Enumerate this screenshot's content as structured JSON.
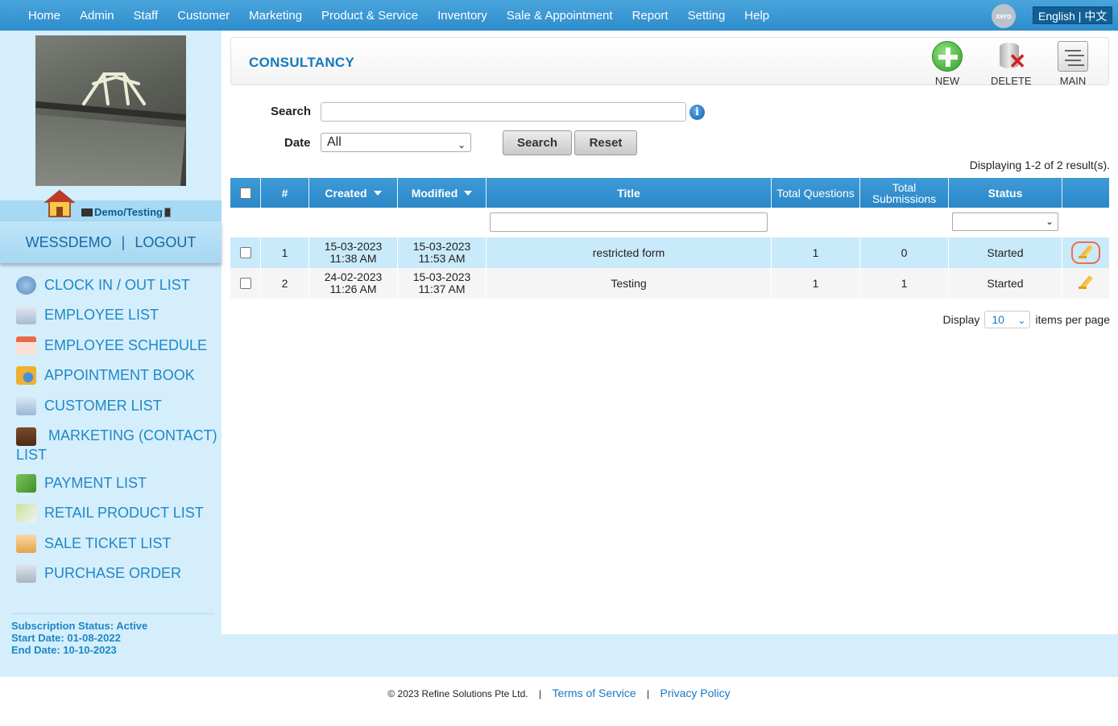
{
  "nav": {
    "items": [
      "Home",
      "Admin",
      "Staff",
      "Customer",
      "Marketing",
      "Product & Service",
      "Inventory",
      "Sale & Appointment",
      "Report",
      "Setting",
      "Help"
    ],
    "xero": "xero",
    "language": "English | 中文"
  },
  "sidebar": {
    "branch_label": "Demo/Testing",
    "username": "WESSDEMO",
    "separator": "|",
    "logout": "LOGOUT",
    "items": [
      {
        "label": "CLOCK IN / OUT LIST",
        "icon": "clock-icon"
      },
      {
        "label": "EMPLOYEE LIST",
        "icon": "employee-card-icon"
      },
      {
        "label": "EMPLOYEE SCHEDULE",
        "icon": "calendar-icon"
      },
      {
        "label": "APPOINTMENT BOOK",
        "icon": "appointment-icon"
      },
      {
        "label": "CUSTOMER LIST",
        "icon": "customer-card-icon"
      },
      {
        "label": "MARKETING (CONTACT) LIST",
        "icon": "contact-book-icon"
      },
      {
        "label": "PAYMENT LIST",
        "icon": "payment-icon"
      },
      {
        "label": "RETAIL PRODUCT LIST",
        "icon": "product-box-icon"
      },
      {
        "label": "SALE TICKET LIST",
        "icon": "ticket-icon"
      },
      {
        "label": "PURCHASE ORDER",
        "icon": "purchase-order-icon"
      }
    ],
    "subscription": {
      "status": "Subscription Status: Active",
      "start": "Start Date: 01-08-2022",
      "end": "End Date: 10-10-2023"
    }
  },
  "page": {
    "title": "CONSULTANCY",
    "toolbar": {
      "new": "NEW",
      "delete": "DELETE",
      "main": "MAIN"
    }
  },
  "form": {
    "search_label": "Search",
    "search_value": "",
    "date_label": "Date",
    "date_value": "All",
    "search_button": "Search",
    "reset_button": "Reset"
  },
  "results": {
    "summary": "Displaying 1-2 of 2 result(s)."
  },
  "table": {
    "headers": {
      "num": "#",
      "created": "Created",
      "modified": "Modified",
      "title": "Title",
      "total_questions": "Total Questions",
      "total_submissions": "Total Submissions",
      "status": "Status"
    },
    "rows": [
      {
        "num": "1",
        "created_date": "15-03-2023",
        "created_time": "11:38 AM",
        "modified_date": "15-03-2023",
        "modified_time": "11:53 AM",
        "title": "restricted form",
        "total_questions": "1",
        "total_submissions": "0",
        "status": "Started"
      },
      {
        "num": "2",
        "created_date": "24-02-2023",
        "created_time": "11:26 AM",
        "modified_date": "15-03-2023",
        "modified_time": "11:37 AM",
        "title": "Testing",
        "total_questions": "1",
        "total_submissions": "1",
        "status": "Started"
      }
    ]
  },
  "paging": {
    "display_label": "Display",
    "per_page": "10",
    "suffix": "items per page"
  },
  "footer": {
    "copyright": "© 2023 Refine Solutions Pte Ltd.",
    "terms": "Terms of Service",
    "privacy": "Privacy Policy",
    "sep": "|"
  }
}
